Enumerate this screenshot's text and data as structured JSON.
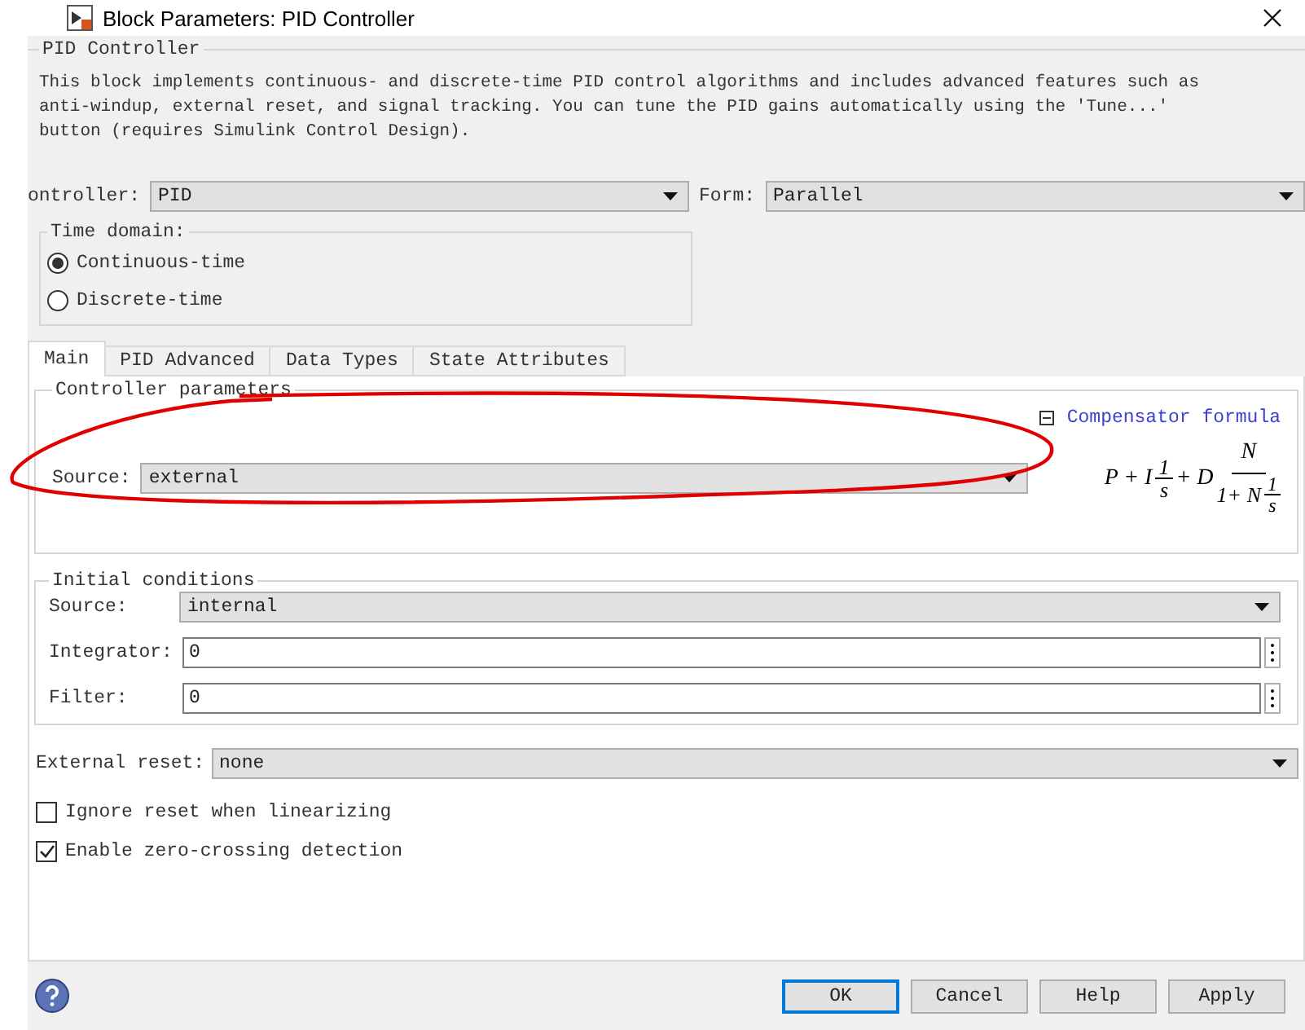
{
  "window": {
    "title": "Block Parameters: PID Controller"
  },
  "block": {
    "title": "PID Controller",
    "description": "This block implements continuous- and discrete-time PID control algorithms and includes advanced features such as anti-windup, external reset, and signal tracking. You can tune the PID gains automatically using the 'Tune...' button (requires Simulink Control Design)."
  },
  "controller": {
    "label": "ontroller:",
    "value": "PID"
  },
  "form": {
    "label": "Form:",
    "value": "Parallel"
  },
  "time_domain": {
    "title": "Time domain:",
    "options": [
      {
        "label": "Continuous-time",
        "selected": true
      },
      {
        "label": "Discrete-time",
        "selected": false
      }
    ]
  },
  "tabs": [
    {
      "label": "Main",
      "selected": true
    },
    {
      "label": "PID Advanced",
      "selected": false
    },
    {
      "label": "Data Types",
      "selected": false
    },
    {
      "label": "State Attributes",
      "selected": false
    }
  ],
  "controller_parameters": {
    "title": "Controller parameters",
    "source_label": "Source:",
    "source_value": "external",
    "formula_link": "Compensator formula",
    "formula_expanded": true,
    "formula": {
      "lead": "P + I",
      "f1_num": "1",
      "f1_den": "s",
      "mid": "+ D",
      "num": "N",
      "den_lead": "1+ N",
      "f2_num": "1",
      "f2_den": "s"
    }
  },
  "initial_conditions": {
    "title": "Initial conditions",
    "source_label": "Source:",
    "source_value": "internal",
    "fields": [
      {
        "label": "Integrator:",
        "value": "0"
      },
      {
        "label": "Filter:",
        "value": "0"
      }
    ]
  },
  "external_reset": {
    "label": "External reset:",
    "value": "none"
  },
  "checkboxes": [
    {
      "label": "Ignore reset when linearizing",
      "checked": false
    },
    {
      "label": "Enable zero-crossing detection",
      "checked": true
    }
  ],
  "buttons": [
    {
      "label": "OK",
      "default": true
    },
    {
      "label": "Cancel",
      "default": false
    },
    {
      "label": "Help",
      "default": false
    },
    {
      "label": "Apply",
      "default": false
    }
  ]
}
